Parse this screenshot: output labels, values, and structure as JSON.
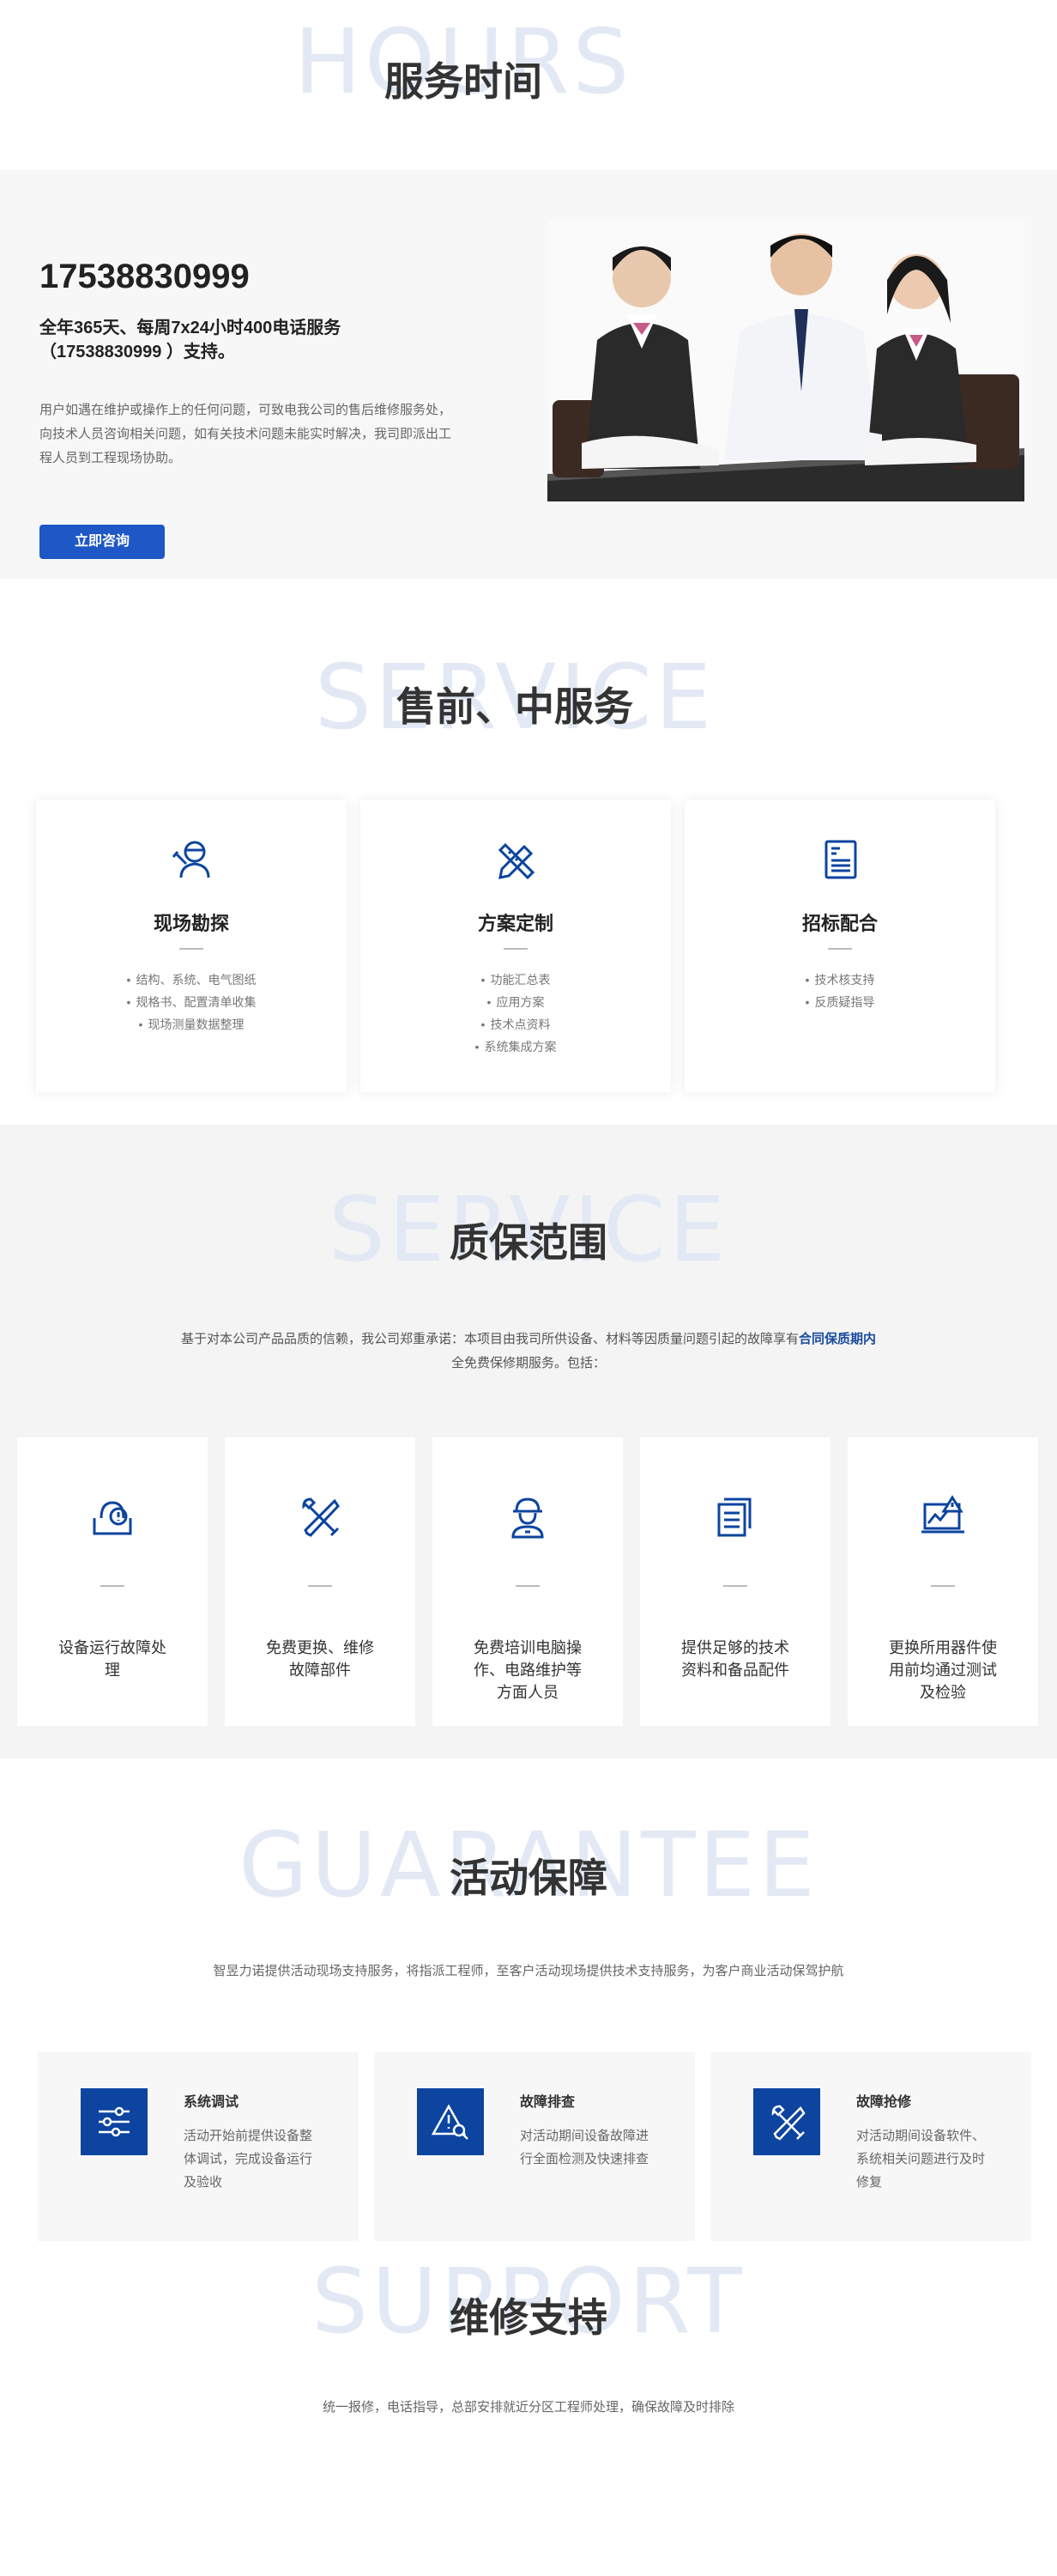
{
  "hours": {
    "bg_word": "HOURS",
    "title": "服务时间",
    "phone": "17538830999",
    "subline": "全年365天、每周7x24小时400电话服务（17538830999 ）支持。",
    "desc": "用户如遇在维护或操作上的任何问题，可致电我公司的售后维修服务处，向技术人员咨询相关问题，如有关技术问题未能实时解决，我司即派出工程人员到工程现场协助。",
    "button": "立即咨询"
  },
  "presale": {
    "bg_word": "SERVICE",
    "title": "售前、中服务",
    "cards": [
      {
        "title": "现场勘探",
        "items": [
          "结构、系统、电气图纸",
          "规格书、配置清单收集",
          "现场测量数据整理"
        ]
      },
      {
        "title": "方案定制",
        "items": [
          "功能汇总表",
          "应用方案",
          "技术点资料",
          "系统集成方案"
        ]
      },
      {
        "title": "招标配合",
        "items": [
          "技术核支持",
          "反质疑指导"
        ]
      }
    ]
  },
  "warranty": {
    "bg_word": "SERVICE",
    "title": "质保范围",
    "intro_pre": "基于对本公司产品品质的信赖，我公司郑重承诺：本项目由我司所供设备、材料等因质量问题引起的故障享有",
    "intro_hl": "合同保质期内",
    "intro_post": "全免费保修期服务。包括：",
    "cards": [
      {
        "title": "设备运行故障处理"
      },
      {
        "title": "免费更换、维修故障部件"
      },
      {
        "title": "免费培训电脑操作、电路维护等方面人员"
      },
      {
        "title": "提供足够的技术资料和备品配件"
      },
      {
        "title": "更换所用器件使用前均通过测试及检验"
      }
    ]
  },
  "activity": {
    "bg_word": "GUARANTEE",
    "title": "活动保障",
    "intro": "智昱力诺提供活动现场支持服务，将指派工程师，至客户活动现场提供技术支持服务，为客户商业活动保驾护航",
    "cards": [
      {
        "title": "系统调试",
        "desc": "活动开始前提供设备整体调试，完成设备运行及验收"
      },
      {
        "title": "故障排查",
        "desc": "对活动期间设备故障进行全面检测及快速排查"
      },
      {
        "title": "故障抢修",
        "desc": "对活动期间设备软件、系统相关问题进行及时修复"
      }
    ]
  },
  "support": {
    "bg_word": "SUPPORT",
    "title": "维修支持",
    "intro": "统一报修，电话指导，总部安排就近分区工程师处理，确保故障及时排除"
  },
  "colors": {
    "accent": "#1e57c6",
    "icon_blue": "#0c449f",
    "bg_word": "#e3e9f4"
  }
}
